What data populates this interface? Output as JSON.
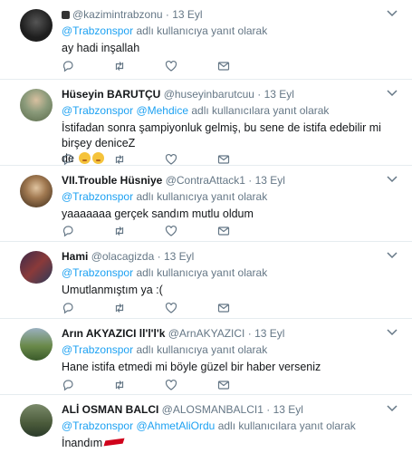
{
  "tweets": [
    {
      "name": "",
      "handle": "@kazimintrabzonu",
      "time": "13 Eyl",
      "mentions": [
        "@Trabzonspor"
      ],
      "reply_suffix": "adlı kullanıcıya yanıt olarak",
      "text": "ay hadi inşallah",
      "avatar_color": "#2b2b2b"
    },
    {
      "name": "Hüseyin BARUTÇU",
      "handle": "@huseyinbarutcuu",
      "time": "13 Eyl",
      "mentions": [
        "@Trabzonspor",
        "@Mehdice"
      ],
      "reply_suffix": "adlı kullanıcılara yanıt olarak",
      "text_line1": "İstifadan sonra şampiyonluk gelmiş, bu sene de istifa edebilir mi birşey deniceZ",
      "text_line2": "de",
      "avatar_color": "#7a8a6a"
    },
    {
      "name": "VII.Trouble Hüsniye",
      "handle": "@ContraAttack1",
      "time": "13 Eyl",
      "mentions": [
        "@Trabzonspor"
      ],
      "reply_suffix": "adlı kullanıcıya yanıt olarak",
      "text": "yaaaaaaa gerçek sandım mutlu oldum",
      "avatar_color": "#a07850"
    },
    {
      "name": "Hami",
      "handle": "@olacagizda",
      "time": "13 Eyl",
      "mentions": [
        "@Trabzonspor"
      ],
      "reply_suffix": "adlı kullanıcıya yanıt olarak",
      "text": "Umutlanmıştım ya :(",
      "avatar_color": "#6b3a3a"
    },
    {
      "name": "Arın AKYAZICI",
      "name_suffix": "ll'l'l'k",
      "handle": "@ArnAKYAZICI",
      "time": "13 Eyl",
      "mentions": [
        "@Trabzonspor"
      ],
      "reply_suffix": "adlı kullanıcıya yanıt olarak",
      "text": "Hane istifa etmedi mi böyle güzel bir haber verseniz",
      "avatar_color": "#5a7a3a"
    },
    {
      "name": "ALİ OSMAN BALCI",
      "handle": "@ALOSMANBALCI1",
      "time": "13 Eyl",
      "mentions": [
        "@Trabzonspor",
        "@AhmetAliOrdu"
      ],
      "reply_suffix": "adlı kullanıcılara yanıt olarak",
      "text": "İnandım",
      "avatar_color": "#4a5a3a"
    }
  ],
  "colors": {
    "link": "#1da1f2",
    "muted": "#657786",
    "divider": "#e6ecf0"
  },
  "icons": [
    "reply-icon",
    "retweet-icon",
    "like-icon",
    "message-icon",
    "chevron-down-icon"
  ]
}
